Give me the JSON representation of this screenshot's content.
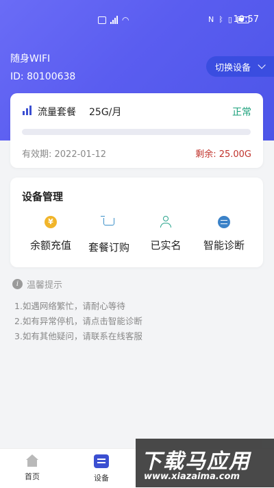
{
  "status_bar": {
    "time": "10:57"
  },
  "device": {
    "name": "随身WIFI",
    "id": "ID:  80100638",
    "switch_label": "切换设备"
  },
  "plan": {
    "label": "流量套餐",
    "size": "25G/月",
    "status": "正常",
    "usage_fraction": 0.0,
    "validity": "有效期:   2022-01-12",
    "remaining": "剩余:  25.00G",
    "colors": {
      "status": "#19a07a",
      "remaining": "#c0322b",
      "accent": "#5a5df0"
    }
  },
  "management": {
    "title": "设备管理",
    "items": [
      {
        "label": "余额充值",
        "icon": "coin-icon"
      },
      {
        "label": "套餐订购",
        "icon": "cart-icon"
      },
      {
        "label": "已实名",
        "icon": "person-icon"
      },
      {
        "label": "智能诊断",
        "icon": "diagnose-icon"
      }
    ]
  },
  "tips": {
    "title": "温馨提示",
    "lines": [
      "1.如遇网络繁忙，请耐心等待",
      "2.如有异常停机，请点击智能诊断",
      "3.如有其他疑问，请联系在线客服"
    ]
  },
  "tabbar": {
    "tabs": [
      {
        "label": "首页",
        "icon": "home-icon"
      },
      {
        "label": "设备",
        "icon": "device-icon"
      }
    ]
  },
  "watermark": {
    "title": "下载马应用",
    "url": "www.xiazaima.com"
  }
}
